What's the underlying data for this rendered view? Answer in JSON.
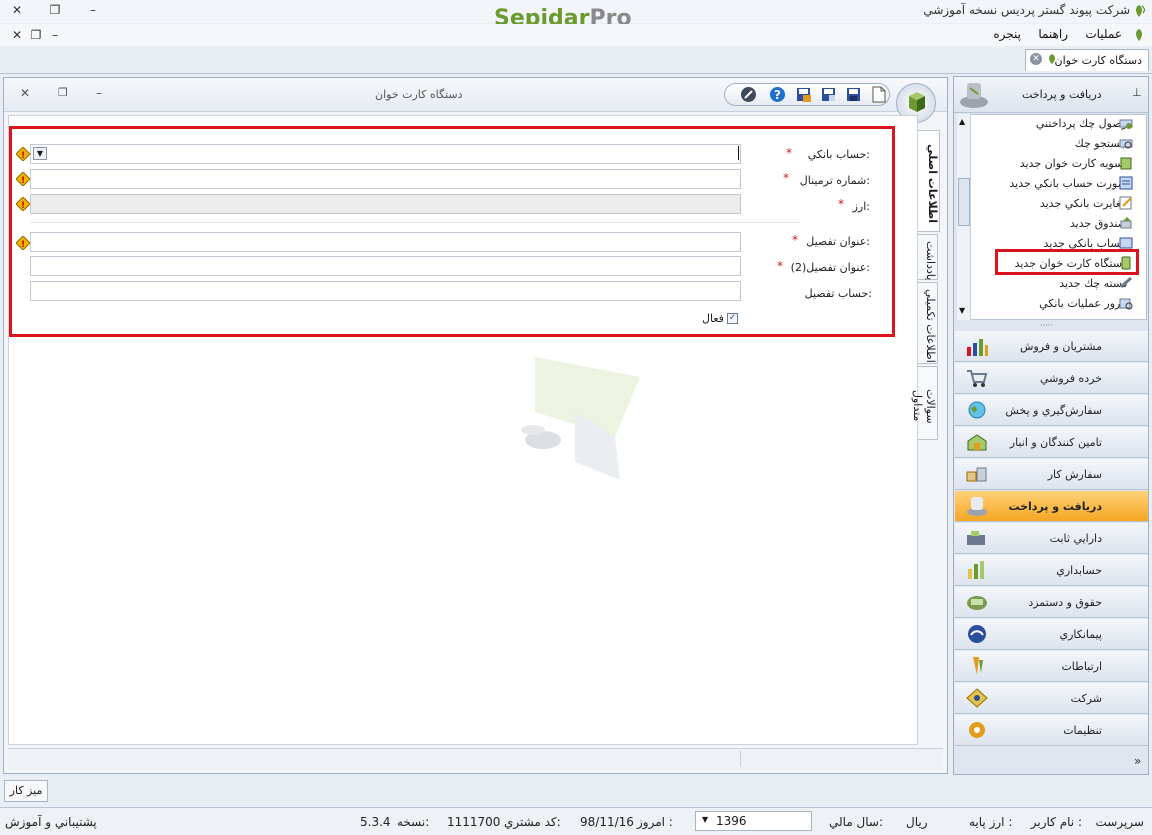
{
  "app": {
    "brand_left": "Sepidar",
    "brand_right": "Pro",
    "company_title": "شرکت پيوند گستر پرديس نسخه آموزشي"
  },
  "menu": {
    "items": [
      "عمليات",
      "راهنما",
      "پنجره"
    ]
  },
  "doc_tab": {
    "label": "دستگاه کارت خوان"
  },
  "form_window": {
    "title": "دستگاه کارت خوان"
  },
  "form": {
    "bank_account_label": "حساب بانکي:",
    "terminal_label": "شماره ترمينال:",
    "currency_label": "ارز:",
    "detail_title_label": "عنوان تفصيل:",
    "detail_title2_label": "عنوان تفصيل(2):",
    "detail_account_label": "حساب تفصيل:",
    "active_label": "فعال",
    "required_mark": "*",
    "bank_account_value": "",
    "terminal_value": "",
    "currency_value": "",
    "detail_title_value": "",
    "detail_title2_value": "",
    "detail_account_value": ""
  },
  "vertical_tabs": [
    "اطلاعات اصلي",
    "يادداشت",
    "اطلاعات تکميلي",
    "سوالات متداول"
  ],
  "right_panel": {
    "header": "دريافت و پرداخت",
    "list_items": [
      "وصول چك پرداختني",
      "جستجو چك",
      "تسويه کارت خوان جديد",
      "صورت حساب بانکي جديد",
      "مغايرت بانکي جديد",
      "صندوق جديد",
      "حساب بانکي جديد",
      "دستگاه کارت خوان جديد",
      "دسته چك جديد",
      "مرور عمليات بانکي"
    ],
    "nav_items": [
      "مشتريان و فروش",
      "خرده فروشي",
      "سفارش‌گيري و پخش",
      "تامين كنندگان و انبار",
      "سفارش کار",
      "دريافت و پرداخت",
      "دارايي ثابت",
      "حسابداري",
      "حقوق و دستمزد",
      "پيمانكاري",
      "ارتباطات",
      "شرکت",
      "تنظيمات"
    ]
  },
  "desktop_button": "ميز كار",
  "status": {
    "username_label": "نام کاربر :",
    "username_value": "سرپرست",
    "base_currency_label": "ارز پايه :",
    "base_currency_value": "ريال",
    "fiscal_year_label": "سال مالي:",
    "fiscal_year_value": "1396",
    "today_label": "امروز :",
    "today_value": "98/11/16",
    "customer_code_label": "کد مشتري:",
    "customer_code_value": "1111700",
    "version_label": "نسخه:",
    "version_value": "5.3.4",
    "support_link": "پشتيباني و آموزش"
  },
  "colors": {
    "highlight_red": "#d9141c",
    "active_nav": "#f5a623",
    "brand_green": "#6c9a2f"
  }
}
